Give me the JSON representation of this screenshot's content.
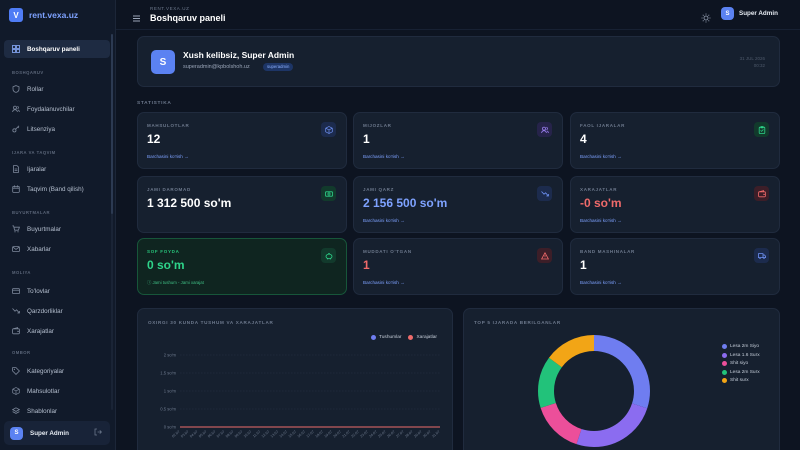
{
  "brand": {
    "name": "rent.vexa.uz",
    "logo_letter": "V"
  },
  "header": {
    "breadcrumb": "RENT.VEXA.UZ",
    "title": "Boshqaruv paneli",
    "user_name": "Super Admin",
    "user_initial": "S"
  },
  "sidebar": {
    "sections": {
      "boshqaruv": "BOSHQARUV",
      "ijara": "IJARA VA TAQVIM",
      "buyurtmalar": "BUYURTMALAR",
      "moliya": "MOLIYA",
      "ombor": "OMBOR"
    },
    "items": [
      {
        "label": "Boshqaruv paneli",
        "icon": "grid-icon"
      },
      {
        "label": "Rollar",
        "icon": "shield-icon"
      },
      {
        "label": "Foydalanuvchilar",
        "icon": "users-icon"
      },
      {
        "label": "Litsenziya",
        "icon": "key-icon"
      },
      {
        "label": "Ijaralar",
        "icon": "document-icon"
      },
      {
        "label": "Taqvim (Band qilish)",
        "icon": "calendar-icon"
      },
      {
        "label": "Buyurtmalar",
        "icon": "cart-icon"
      },
      {
        "label": "Xabarlar",
        "icon": "mail-icon"
      },
      {
        "label": "To'lovlar",
        "icon": "card-icon"
      },
      {
        "label": "Qarzdorliklar",
        "icon": "trend-down-icon"
      },
      {
        "label": "Xarajatlar",
        "icon": "wallet-icon"
      },
      {
        "label": "Kategoriyalar",
        "icon": "tag-icon"
      },
      {
        "label": "Mahsulotlar",
        "icon": "box-icon"
      },
      {
        "label": "Shablonlar",
        "icon": "layers-icon"
      }
    ],
    "user": {
      "name": "Super Admin",
      "initial": "S"
    }
  },
  "welcome": {
    "title": "Xush kelibsiz, Super Admin",
    "email": "superadmin@kpbolshoh.uz",
    "role": "superadmin",
    "date": "31 JUL 2026",
    "time": "00:32",
    "initial": "S"
  },
  "statistics_label": "STATISTIKA",
  "stats": [
    {
      "label": "MAHSULOTLAR",
      "value": "12",
      "link": "Barchasini ko'rish →",
      "icon": "cube-icon",
      "color": "#5b82f2"
    },
    {
      "label": "MIJOZLAR",
      "value": "1",
      "link": "Barchasini ko'rish →",
      "icon": "users-icon",
      "color": "#8b6cf0"
    },
    {
      "label": "FAOL IJARALAR",
      "value": "4",
      "link": "Barchasini ko'rish →",
      "icon": "clipboard-icon",
      "color": "#22c27a"
    },
    {
      "label": "JAMI DAROMAD",
      "value": "1 312 500 so'm",
      "link": "",
      "icon": "cash-icon",
      "color": "#22c27a"
    },
    {
      "label": "JAMI QARZ",
      "value": "2 156 500 so'm",
      "link": "Barchasini ko'rish →",
      "icon": "trend-down-icon",
      "color": "#5b82f2"
    },
    {
      "label": "XARAJATLAR",
      "value": "-0 so'm",
      "link": "Barchasini ko'rish →",
      "icon": "wallet-icon",
      "color": "#ee5d5d"
    },
    {
      "label": "SOF FOYDA",
      "value": "0 so'm",
      "sub": "Jami tushum - Jami xarajat",
      "icon": "piggy-icon",
      "color": "#22c27a"
    },
    {
      "label": "MUDDATI O'TGAN",
      "value": "1",
      "link": "Barchasini ko'rish →",
      "icon": "alert-icon",
      "color": "#ee5d5d"
    },
    {
      "label": "BAND MASHINALAR",
      "value": "1",
      "link": "Barchasini ko'rish →",
      "icon": "truck-icon",
      "color": "#5b82f2"
    }
  ],
  "line_panel": {
    "title": "OXIRGI 30 KUNDA TUSHUM VA XARAJATLAR",
    "legend": [
      "Tushumlar",
      "Xarajatlar"
    ],
    "colors": {
      "income": "#6f7df0",
      "expense": "#ee6b6b"
    },
    "y_ticks": [
      "2 so'm",
      "1.5 so'm",
      "1 so'm",
      "0.5 so'm",
      "0 so'm"
    ],
    "x_ticks": [
      "02.07",
      "03.07",
      "04.07",
      "05.07",
      "06.07",
      "07.07",
      "08.07",
      "09.07",
      "10.07",
      "11.07",
      "12.07",
      "13.07",
      "14.07",
      "15.07",
      "16.07",
      "17.07",
      "18.07",
      "19.07",
      "20.07",
      "21.07",
      "22.07",
      "23.07",
      "24.07",
      "25.07",
      "26.07",
      "27.07",
      "28.07",
      "29.07",
      "30.07",
      "31.07"
    ]
  },
  "donut_panel": {
    "title": "TOP 5 IJARADA BERILGANLAR",
    "items": [
      {
        "label": "Lesa 2m Siyo",
        "value": 30,
        "color": "#6f7df0"
      },
      {
        "label": "Lesa 1.6 Surx",
        "value": 25,
        "color": "#8b6cf0"
      },
      {
        "label": "Shit siyo",
        "value": 15,
        "color": "#ec4f9a"
      },
      {
        "label": "Lesa 2m Surx",
        "value": 15,
        "color": "#22c27a"
      },
      {
        "label": "Shit surx",
        "value": 15,
        "color": "#f2a516"
      }
    ]
  }
}
